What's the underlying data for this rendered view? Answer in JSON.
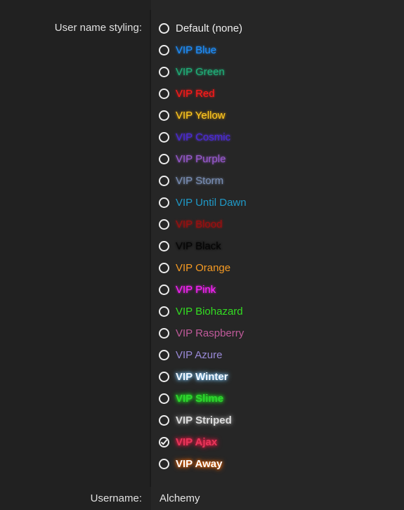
{
  "labels": {
    "styling": "User name styling:",
    "username": "Username:"
  },
  "username_value": "Alchemy",
  "selected_option": "VIP Ajax",
  "options": [
    {
      "label": "Default (none)",
      "color": "#eeeeee",
      "glow": "",
      "bold": false
    },
    {
      "label": "VIP Blue",
      "color": "#1e90ff",
      "glow": "#1e90ff",
      "bold": false
    },
    {
      "label": "VIP Green",
      "color": "#20b27a",
      "glow": "#20b27a",
      "bold": false
    },
    {
      "label": "VIP Red",
      "color": "#ff1a1a",
      "glow": "#ff1a1a",
      "bold": false
    },
    {
      "label": "VIP Yellow",
      "color": "#ffcc22",
      "glow": "#ffaa00",
      "bold": false
    },
    {
      "label": "VIP Cosmic",
      "color": "#4a2ad8",
      "glow": "#6a3cff",
      "bold": false
    },
    {
      "label": "VIP Purple",
      "color": "#9a5ad0",
      "glow": "#9a5ad0",
      "bold": false
    },
    {
      "label": "VIP Storm",
      "color": "#7a8fb5",
      "glow": "#7a8fb5",
      "bold": false
    },
    {
      "label": "VIP Until Dawn",
      "color": "#1f9ac8",
      "glow": "",
      "bold": false
    },
    {
      "label": "VIP Blood",
      "color": "#9a0f0f",
      "glow": "#c01010",
      "bold": false
    },
    {
      "label": "VIP Black",
      "color": "#050505",
      "glow": "#000000",
      "bold": false
    },
    {
      "label": "VIP Orange",
      "color": "#f59a23",
      "glow": "",
      "bold": false
    },
    {
      "label": "VIP Pink",
      "color": "#ff22ff",
      "glow": "#ff22ff",
      "bold": false
    },
    {
      "label": "VIP Biohazard",
      "color": "#33dd22",
      "glow": "",
      "bold": false
    },
    {
      "label": "VIP Raspberry",
      "color": "#c05a9a",
      "glow": "",
      "bold": false
    },
    {
      "label": "VIP Azure",
      "color": "#9a8ad8",
      "glow": "",
      "bold": false
    },
    {
      "label": "VIP Winter",
      "color": "#f2f8ff",
      "glow": "#7ec8ff",
      "bold": true
    },
    {
      "label": "VIP Slime",
      "color": "#2ed62e",
      "glow": "#22ff22",
      "bold": true
    },
    {
      "label": "VIP Striped",
      "color": "#dcdcdc",
      "glow": "#888888",
      "bold": true
    },
    {
      "label": "VIP Ajax",
      "color": "#e8365a",
      "glow": "#ff1a4a",
      "bold": true
    },
    {
      "label": "VIP Away",
      "color": "#ffffff",
      "glow": "#ff6a00",
      "bold": true
    }
  ]
}
